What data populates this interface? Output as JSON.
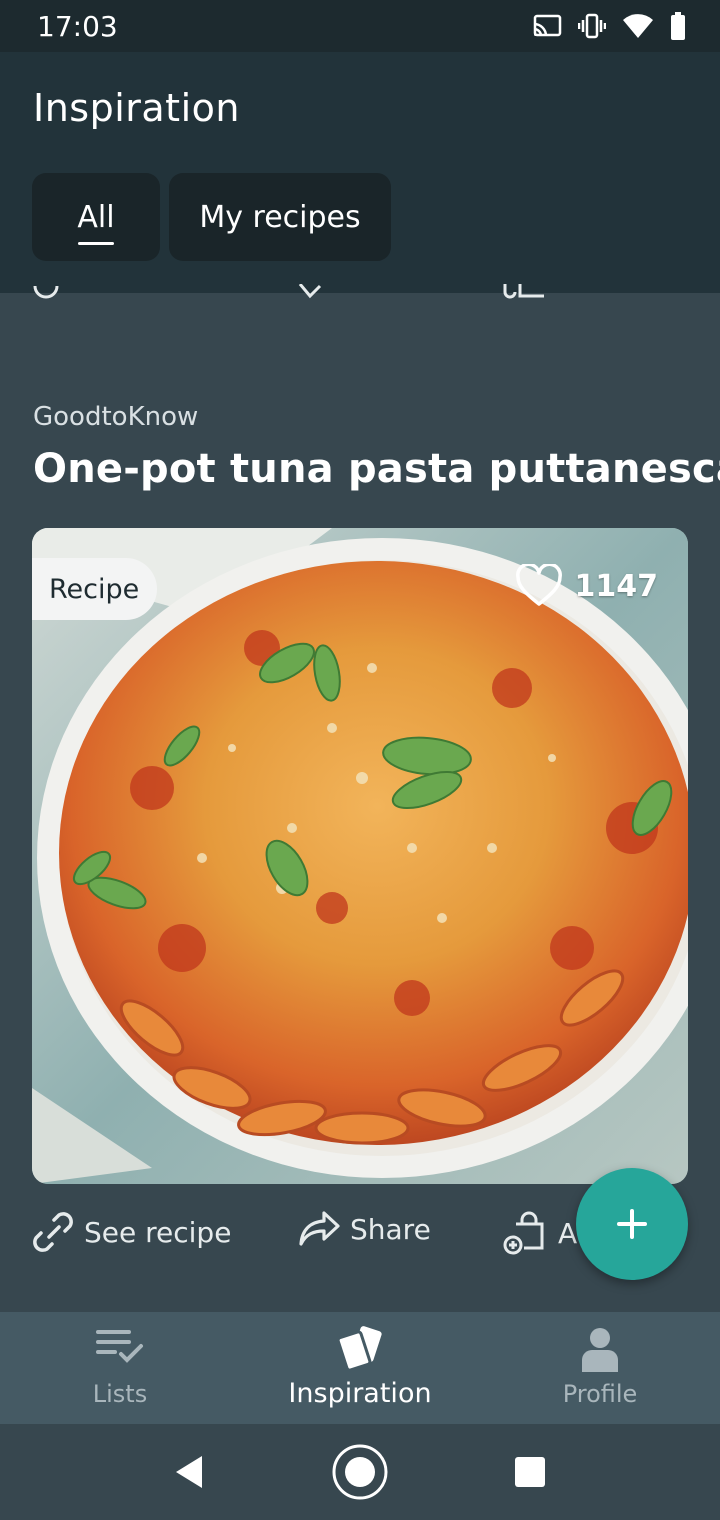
{
  "status_bar": {
    "time": "17:03",
    "icons": [
      "cast-icon",
      "vibrate-icon",
      "wifi-icon",
      "battery-icon"
    ]
  },
  "header": {
    "title": "Inspiration",
    "tabs": [
      {
        "label": "All",
        "selected": true
      },
      {
        "label": "My recipes",
        "selected": false
      }
    ]
  },
  "card": {
    "source": "GoodtoKnow",
    "title": "One-pot tuna pasta puttanesca",
    "badge": "Recipe",
    "likes": "1147",
    "image_icon": "pasta-bake-photo",
    "actions": [
      {
        "label": "See recipe",
        "icon": "link-icon"
      },
      {
        "label": "Share",
        "icon": "share-icon"
      },
      {
        "label": "Add",
        "icon": "add-to-basket-icon"
      }
    ]
  },
  "fab": {
    "icon": "plus-icon"
  },
  "bottom_nav": {
    "items": [
      {
        "label": "Lists",
        "icon": "checklist-icon",
        "active": false
      },
      {
        "label": "Inspiration",
        "icon": "cards-icon",
        "active": true
      },
      {
        "label": "Profile",
        "icon": "person-icon",
        "active": false
      }
    ]
  },
  "colors": {
    "background": "#37474f",
    "header": "#22333a",
    "accent": "#26a69a",
    "nav": "#455a64"
  }
}
